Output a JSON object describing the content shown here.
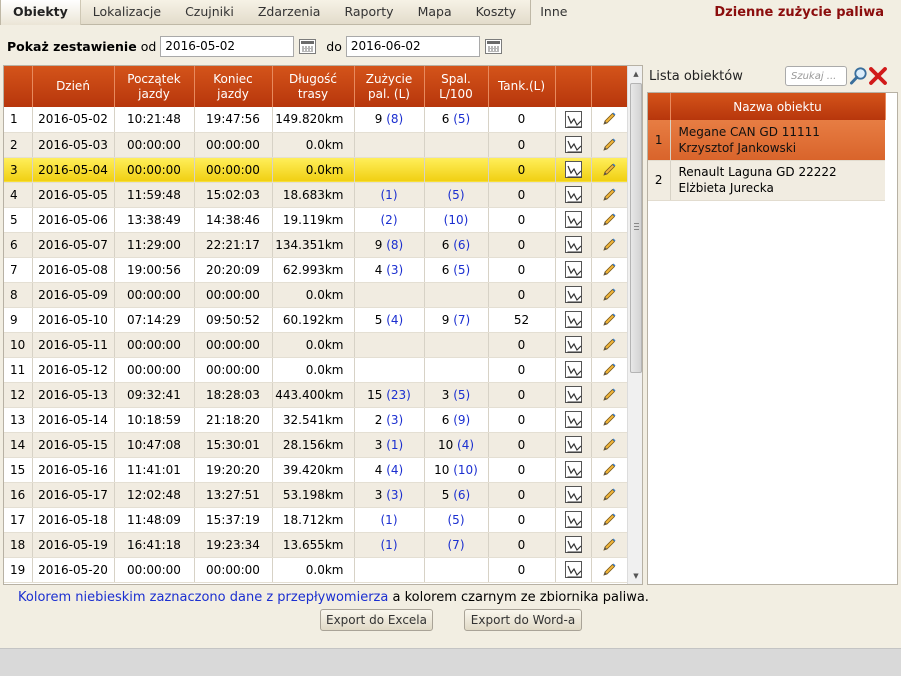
{
  "menu": {
    "items": [
      "Obiekty",
      "Lokalizacje",
      "Czujniki",
      "Zdarzenia",
      "Raporty",
      "Mapa",
      "Koszty",
      "Inne"
    ],
    "active_index": 0
  },
  "page_heading": "Dzienne zużycie paliwa",
  "filter": {
    "label": "Pokaż zestawienie",
    "from_label": "od",
    "from_value": "2016-05-02",
    "to_label": "do",
    "to_value": "2016-06-02"
  },
  "table": {
    "headers": [
      "",
      "Dzień",
      "Początek jazdy",
      "Koniec jazdy",
      "Długość trasy",
      "Zużycie pal. (L)",
      "Spal. L/100",
      "Tank.(L)",
      "",
      ""
    ],
    "selected_row": 2,
    "rows": [
      {
        "no": "1",
        "day": "2016-05-02",
        "start": "10:21:48",
        "end": "19:47:56",
        "length": "149.820km",
        "usage": "9",
        "usage_flow": "(8)",
        "spal": "6",
        "spal_flow": "(5)",
        "tank": "0"
      },
      {
        "no": "2",
        "day": "2016-05-03",
        "start": "00:00:00",
        "end": "00:00:00",
        "length": "0.0km",
        "usage": "",
        "usage_flow": "",
        "spal": "",
        "spal_flow": "",
        "tank": "0"
      },
      {
        "no": "3",
        "day": "2016-05-04",
        "start": "00:00:00",
        "end": "00:00:00",
        "length": "0.0km",
        "usage": "",
        "usage_flow": "",
        "spal": "",
        "spal_flow": "",
        "tank": "0"
      },
      {
        "no": "4",
        "day": "2016-05-05",
        "start": "11:59:48",
        "end": "15:02:03",
        "length": "18.683km",
        "usage": "",
        "usage_flow": "(1)",
        "spal": "",
        "spal_flow": "(5)",
        "tank": "0"
      },
      {
        "no": "5",
        "day": "2016-05-06",
        "start": "13:38:49",
        "end": "14:38:46",
        "length": "19.119km",
        "usage": "",
        "usage_flow": "(2)",
        "spal": "",
        "spal_flow": "(10)",
        "tank": "0"
      },
      {
        "no": "6",
        "day": "2016-05-07",
        "start": "11:29:00",
        "end": "22:21:17",
        "length": "134.351km",
        "usage": "9",
        "usage_flow": "(8)",
        "spal": "6",
        "spal_flow": "(6)",
        "tank": "0"
      },
      {
        "no": "7",
        "day": "2016-05-08",
        "start": "19:00:56",
        "end": "20:20:09",
        "length": "62.993km",
        "usage": "4",
        "usage_flow": "(3)",
        "spal": "6",
        "spal_flow": "(5)",
        "tank": "0"
      },
      {
        "no": "8",
        "day": "2016-05-09",
        "start": "00:00:00",
        "end": "00:00:00",
        "length": "0.0km",
        "usage": "",
        "usage_flow": "",
        "spal": "",
        "spal_flow": "",
        "tank": "0"
      },
      {
        "no": "9",
        "day": "2016-05-10",
        "start": "07:14:29",
        "end": "09:50:52",
        "length": "60.192km",
        "usage": "5",
        "usage_flow": "(4)",
        "spal": "9",
        "spal_flow": "(7)",
        "tank": "52"
      },
      {
        "no": "10",
        "day": "2016-05-11",
        "start": "00:00:00",
        "end": "00:00:00",
        "length": "0.0km",
        "usage": "",
        "usage_flow": "",
        "spal": "",
        "spal_flow": "",
        "tank": "0"
      },
      {
        "no": "11",
        "day": "2016-05-12",
        "start": "00:00:00",
        "end": "00:00:00",
        "length": "0.0km",
        "usage": "",
        "usage_flow": "",
        "spal": "",
        "spal_flow": "",
        "tank": "0"
      },
      {
        "no": "12",
        "day": "2016-05-13",
        "start": "09:32:41",
        "end": "18:28:03",
        "length": "443.400km",
        "usage": "15",
        "usage_flow": "(23)",
        "spal": "3",
        "spal_flow": "(5)",
        "tank": "0"
      },
      {
        "no": "13",
        "day": "2016-05-14",
        "start": "10:18:59",
        "end": "21:18:20",
        "length": "32.541km",
        "usage": "2",
        "usage_flow": "(3)",
        "spal": "6",
        "spal_flow": "(9)",
        "tank": "0"
      },
      {
        "no": "14",
        "day": "2016-05-15",
        "start": "10:47:08",
        "end": "15:30:01",
        "length": "28.156km",
        "usage": "3",
        "usage_flow": "(1)",
        "spal": "10",
        "spal_flow": "(4)",
        "tank": "0"
      },
      {
        "no": "15",
        "day": "2016-05-16",
        "start": "11:41:01",
        "end": "19:20:20",
        "length": "39.420km",
        "usage": "4",
        "usage_flow": "(4)",
        "spal": "10",
        "spal_flow": "(10)",
        "tank": "0"
      },
      {
        "no": "16",
        "day": "2016-05-17",
        "start": "12:02:48",
        "end": "13:27:51",
        "length": "53.198km",
        "usage": "3",
        "usage_flow": "(3)",
        "spal": "5",
        "spal_flow": "(6)",
        "tank": "0"
      },
      {
        "no": "17",
        "day": "2016-05-18",
        "start": "11:48:09",
        "end": "15:37:19",
        "length": "18.712km",
        "usage": "",
        "usage_flow": "(1)",
        "spal": "",
        "spal_flow": "(5)",
        "tank": "0"
      },
      {
        "no": "18",
        "day": "2016-05-19",
        "start": "16:41:18",
        "end": "19:23:34",
        "length": "13.655km",
        "usage": "",
        "usage_flow": "(1)",
        "spal": "",
        "spal_flow": "(7)",
        "tank": "0"
      },
      {
        "no": "19",
        "day": "2016-05-20",
        "start": "00:00:00",
        "end": "00:00:00",
        "length": "0.0km",
        "usage": "",
        "usage_flow": "",
        "spal": "",
        "spal_flow": "",
        "tank": "0"
      }
    ]
  },
  "objects": {
    "title": "Lista obiektów",
    "search_placeholder": "Szukaj ...",
    "header": "Nazwa obiektu",
    "selected_index": 0,
    "items": [
      {
        "no": "1",
        "name": "Megane CAN GD 11111",
        "owner": "Krzysztof Jankowski"
      },
      {
        "no": "2",
        "name": "Renault Laguna GD 22222",
        "owner": "Elżbieta Jurecka"
      }
    ]
  },
  "legend": {
    "blue_text": "Kolorem niebieskim zaznaczono dane z przepływomierza",
    "black_text": " a kolorem czarnym ze zbiornika paliwa."
  },
  "buttons": {
    "export_excel": "Export do Excela",
    "export_word": "Export do Word-a"
  },
  "colors": {
    "header": "#c4451a",
    "heading_text": "#8b0d0d",
    "flowmeter_blue": "#1b2fd0",
    "selected_row": "#f5d82a",
    "selected_object": "#e0703a"
  },
  "icons": {
    "row_chart": "line-chart-icon",
    "row_edit": "pencil-icon",
    "search": "magnifier-icon",
    "clear": "red-x-icon",
    "calendar": "calendar-icon"
  }
}
